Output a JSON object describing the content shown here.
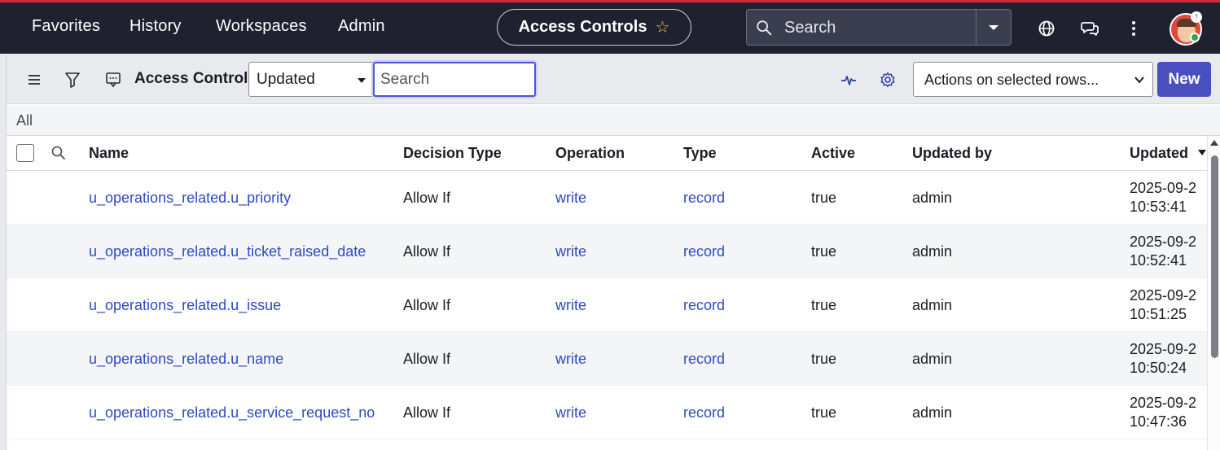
{
  "topnav": {
    "items": [
      "Favorites",
      "History",
      "Workspaces",
      "Admin"
    ],
    "context_title": "Access Controls",
    "search_placeholder": "Search",
    "icons": [
      "search-icon",
      "chevron-down-icon",
      "globe-icon",
      "chat-icon",
      "more-vertical-icon"
    ]
  },
  "toolbar": {
    "title": "Access Controls",
    "field_select_value": "Updated",
    "search_placeholder": "Search",
    "actions_select_value": "Actions on selected rows...",
    "new_label": "New",
    "icons": [
      "menu-icon",
      "filter-icon",
      "list-context-icon",
      "activity-icon",
      "settings-icon"
    ]
  },
  "breadcrumb": "All",
  "table": {
    "columns": [
      "Name",
      "Decision Type",
      "Operation",
      "Type",
      "Active",
      "Updated by",
      "Updated"
    ],
    "sort_column": "Updated",
    "rows": [
      {
        "name": "u_operations_related.u_priority",
        "decision": "Allow If",
        "operation": "write",
        "type": "record",
        "active": "true",
        "updated_by": "admin",
        "updated_date": "2025-09-2",
        "updated_time": "10:53:41"
      },
      {
        "name": "u_operations_related.u_ticket_raised_date",
        "decision": "Allow If",
        "operation": "write",
        "type": "record",
        "active": "true",
        "updated_by": "admin",
        "updated_date": "2025-09-2",
        "updated_time": "10:52:41"
      },
      {
        "name": "u_operations_related.u_issue",
        "decision": "Allow If",
        "operation": "write",
        "type": "record",
        "active": "true",
        "updated_by": "admin",
        "updated_date": "2025-09-2",
        "updated_time": "10:51:25"
      },
      {
        "name": "u_operations_related.u_name",
        "decision": "Allow If",
        "operation": "write",
        "type": "record",
        "active": "true",
        "updated_by": "admin",
        "updated_date": "2025-09-2",
        "updated_time": "10:50:24"
      },
      {
        "name": "u_operations_related.u_service_request_no",
        "decision": "Allow If",
        "operation": "write",
        "type": "record",
        "active": "true",
        "updated_by": "admin",
        "updated_date": "2025-09-2",
        "updated_time": "10:47:36"
      }
    ]
  },
  "colors": {
    "topbar": "#1f2130",
    "accent_line": "#d62a3a",
    "link": "#2d4ac4",
    "primary_button": "#4a4fbf",
    "star": "#f3c14b",
    "presence": "#2fa84f"
  }
}
